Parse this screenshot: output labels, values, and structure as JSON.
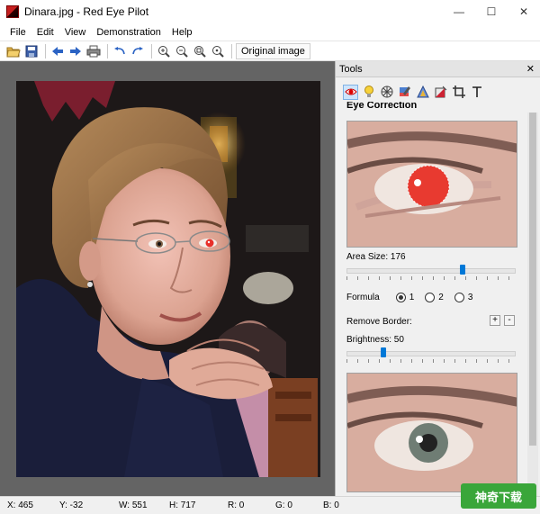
{
  "window": {
    "title": "Dinara.jpg - Red Eye Pilot",
    "controls": {
      "minimize": "—",
      "maximize": "☐",
      "close": "✕"
    }
  },
  "menu": [
    "File",
    "Edit",
    "View",
    "Demonstration",
    "Help"
  ],
  "toolbar": {
    "buttons": [
      "open-folder-icon",
      "save-icon",
      "back-arrow-icon",
      "forward-arrow-icon",
      "print-icon",
      "undo-icon",
      "redo-icon",
      "zoom-in-icon",
      "zoom-out-icon",
      "zoom-fit-icon",
      "zoom-actual-icon"
    ],
    "original_image_label": "Original image"
  },
  "tools_panel": {
    "title": "Tools",
    "close_label": "✕",
    "tool_icons": [
      "eye-icon",
      "bulb-icon",
      "aperture-icon",
      "brush-icon",
      "triangle-icon",
      "crop-fill-icon",
      "crop-icon",
      "text-icon"
    ],
    "active_tool": "eye-icon",
    "section_title": "Eye Correction",
    "area_size": {
      "label": "Area Size: 176",
      "value": 176,
      "position_fraction": 0.68
    },
    "formula": {
      "label": "Formula",
      "options": [
        "1",
        "2",
        "3"
      ],
      "selected": "1"
    },
    "remove_border": {
      "label": "Remove Border:",
      "plus": "+",
      "minus": "-"
    },
    "brightness": {
      "label": "Brightness: 50",
      "value": 50,
      "position_fraction": 0.21
    }
  },
  "status": {
    "x": "X: 465",
    "y": "Y: -32",
    "w": "W: 551",
    "h": "H: 717",
    "r": "R: 0",
    "g": "G: 0",
    "b": "B: 0"
  },
  "watermark": "神奇下载",
  "colors": {
    "accent": "#0078d7",
    "photo_background": "#1b1616",
    "red_eye": "#e8302a",
    "workspace": "#646464"
  }
}
